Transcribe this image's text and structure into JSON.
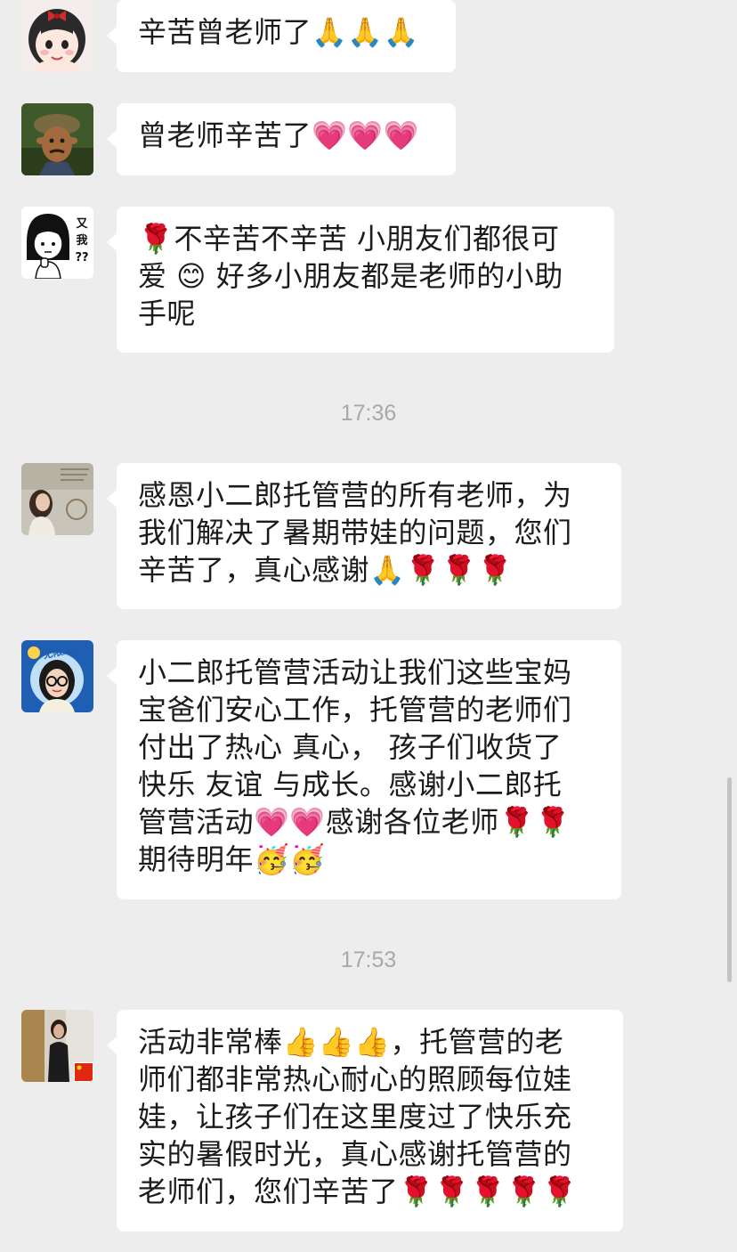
{
  "messages": [
    {
      "text": "辛苦曾老师了🙏🙏🙏",
      "avatar": "girl-avatar"
    },
    {
      "text": "曾老师辛苦了💗💗💗",
      "avatar": "cartoon-man-avatar"
    },
    {
      "text": "🌹不辛苦不辛苦 小朋友们都很可\n爱 😊 好多小朋友都是老师的小助\n手呢",
      "avatar": "comic-girl-avatar"
    },
    {
      "text": "感恩小二郎托管营的所有老师，为\n我们解决了暑期带娃的问题，您们\n辛苦了，真心感谢🙏🌹🌹🌹",
      "avatar": "girl-photo-avatar"
    },
    {
      "text": "小二郎托管营活动让我们这些宝妈\n宝爸们安心工作，托管营的老师们\n付出了热心 真心， 孩子们收货了\n快乐 友谊 与成长。感谢小二郎托\n管营活动💗💗感谢各位老师🌹🌹\n期待明年🥳🥳",
      "avatar": "woman-glasses-avatar",
      "avatar_badge": "无限进步"
    },
    {
      "text": "活动非常棒👍👍👍，托管营的老\n师们都非常热心耐心的照顾每位娃\n娃，让孩子们在这里度过了快乐充\n实的暑假时光，真心感谢托管营的\n老师们，您们辛苦了🌹🌹🌹🌹🌹",
      "avatar": "woman-photo-avatar"
    }
  ],
  "timestamps": [
    "17:36",
    "17:53"
  ],
  "comic_avatar_text": "又\n我\n??",
  "colors": {
    "background": "#ededed",
    "bubble": "#ffffff",
    "timestamp": "#a8a8a8"
  }
}
